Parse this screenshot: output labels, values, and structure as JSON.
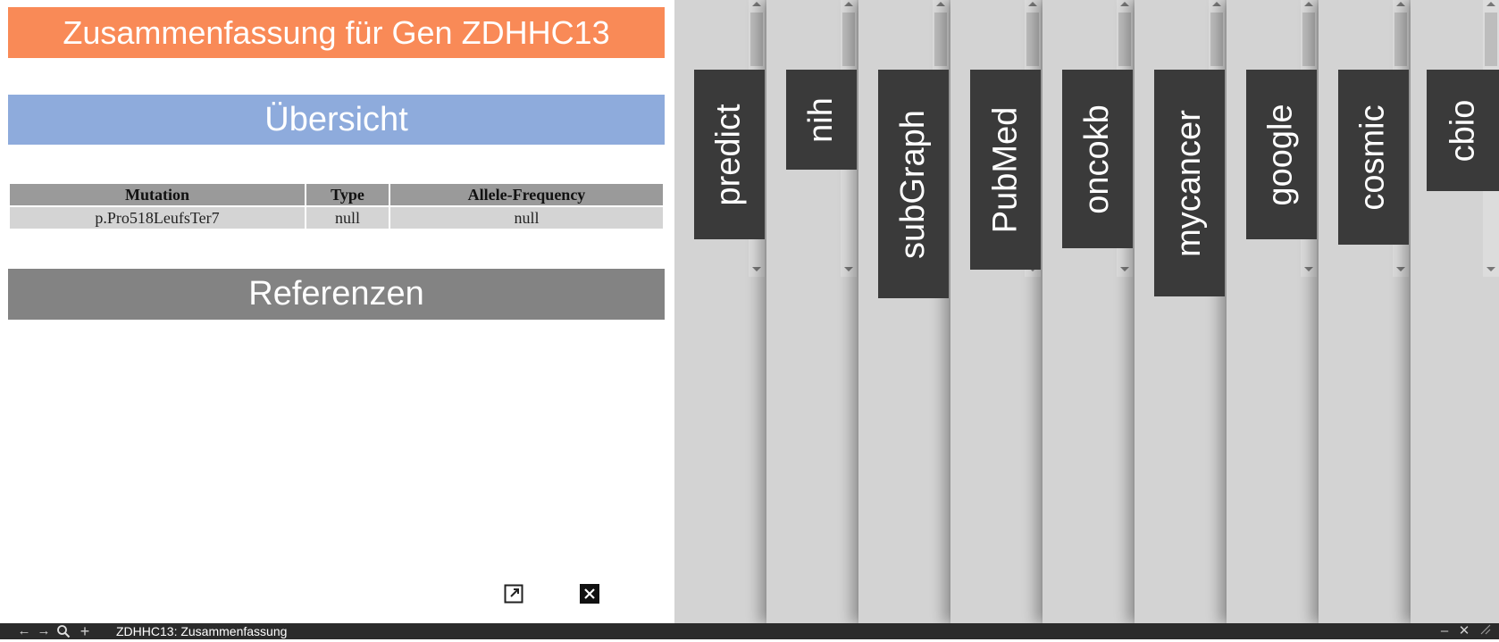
{
  "summary": {
    "title": "Zusammenfassung für Gen ZDHHC13",
    "overview_heading": "Übersicht",
    "table": {
      "headers": [
        "Mutation",
        "Type",
        "Allele-Frequency"
      ],
      "rows": [
        [
          "p.Pro518LeufsTer7",
          "null",
          "null"
        ]
      ]
    },
    "references_heading": "Referenzen"
  },
  "tabs": [
    "predict",
    "nih",
    "subGraph",
    "PubMed",
    "oncokb",
    "mycancer",
    "google",
    "cosmic",
    "cbio"
  ],
  "taskbar": {
    "title": "ZDHHC13: Zusammenfassung"
  },
  "colors": {
    "title_bar": "#f98a57",
    "overview_bar": "#8eabdc",
    "references_bar": "#838383",
    "tab_label_bg": "#3a3a3a"
  },
  "icons": {
    "open_external": "external-link-icon",
    "close": "close-icon",
    "back": "back-arrow-icon",
    "forward": "forward-arrow-icon",
    "search": "search-icon",
    "add": "plus-icon",
    "minimize": "minimize-icon",
    "window_close": "window-close-icon",
    "resize": "resize-icon"
  }
}
